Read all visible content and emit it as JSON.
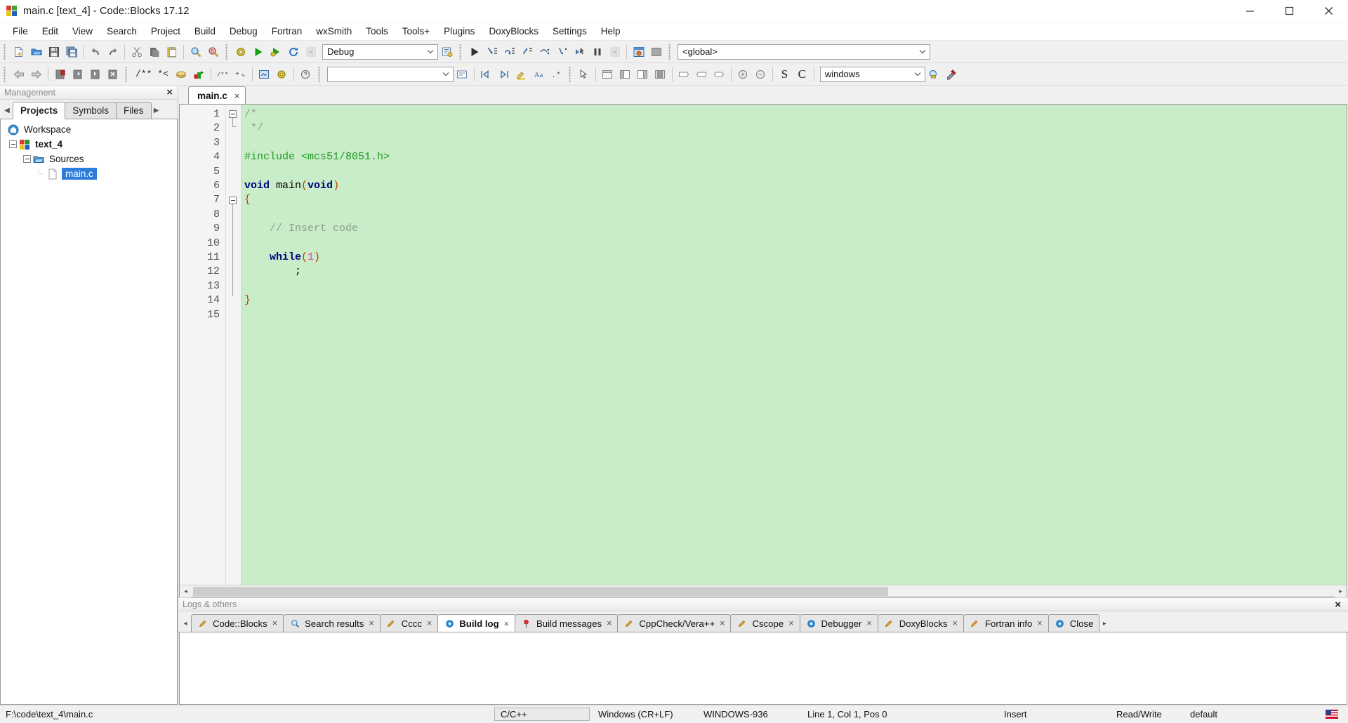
{
  "window": {
    "title": "main.c [text_4] - Code::Blocks 17.12",
    "app_icon": "codeblocks-logo-icon",
    "minimize_label": "Minimize",
    "maximize_label": "Maximize",
    "close_label": "Close"
  },
  "menubar": {
    "items": [
      {
        "label": "File"
      },
      {
        "label": "Edit"
      },
      {
        "label": "View"
      },
      {
        "label": "Search"
      },
      {
        "label": "Project"
      },
      {
        "label": "Build"
      },
      {
        "label": "Debug"
      },
      {
        "label": "Fortran"
      },
      {
        "label": "wxSmith"
      },
      {
        "label": "Tools"
      },
      {
        "label": "Tools+"
      },
      {
        "label": "Plugins"
      },
      {
        "label": "DoxyBlocks"
      },
      {
        "label": "Settings"
      },
      {
        "label": "Help"
      }
    ]
  },
  "toolbar_main": {
    "buttons": [
      {
        "name": "new-file-icon",
        "title": "New file"
      },
      {
        "name": "open-file-icon",
        "title": "Open"
      },
      {
        "name": "save-icon",
        "title": "Save"
      },
      {
        "name": "save-all-icon",
        "title": "Save all files"
      },
      {
        "name": "undo-icon",
        "title": "Undo"
      },
      {
        "name": "redo-icon",
        "title": "Redo"
      },
      {
        "name": "cut-icon",
        "title": "Cut"
      },
      {
        "name": "copy-icon",
        "title": "Copy"
      },
      {
        "name": "paste-icon",
        "title": "Paste"
      },
      {
        "name": "find-icon",
        "title": "Find"
      },
      {
        "name": "replace-icon",
        "title": "Replace"
      },
      {
        "name": "build-icon",
        "title": "Build"
      },
      {
        "name": "run-icon",
        "title": "Run"
      },
      {
        "name": "build-and-run-icon",
        "title": "Build and run"
      },
      {
        "name": "rebuild-icon",
        "title": "Rebuild"
      },
      {
        "name": "abort-icon",
        "title": "Abort"
      }
    ],
    "target_combo": {
      "value": "Debug",
      "name": "build-target-select"
    },
    "select-target-icon": "select-target-icon",
    "debug_buttons": [
      {
        "name": "debug-continue-icon",
        "title": "Debug / Continue"
      },
      {
        "name": "step-into-icon",
        "title": "Step into"
      },
      {
        "name": "step-over-icon",
        "title": "Next line"
      },
      {
        "name": "step-out-icon",
        "title": "Step out"
      },
      {
        "name": "next-instruction-icon",
        "title": "Next instruction"
      },
      {
        "name": "step-into-instruction-icon",
        "title": "Step into instruction"
      },
      {
        "name": "run-to-cursor-icon",
        "title": "Run to cursor"
      },
      {
        "name": "break-debugger-icon",
        "title": "Break debugger"
      },
      {
        "name": "stop-debugger-icon",
        "title": "Stop debugger"
      }
    ],
    "debug_windows_icon": "debugging-windows-icon",
    "debug_info_icon": "various-info-icon",
    "scope_combo": {
      "value": "<global>",
      "name": "scope-select"
    }
  },
  "toolbar_secondary": {
    "nav_buttons": [
      {
        "name": "back-icon",
        "title": "Navigate back"
      },
      {
        "name": "forward-icon",
        "title": "Navigate forward"
      }
    ],
    "bookmark_buttons": [
      {
        "name": "toggle-bookmark-icon",
        "title": "Toggle bookmark"
      },
      {
        "name": "previous-bookmark-icon",
        "title": "Previous bookmark"
      },
      {
        "name": "next-bookmark-icon",
        "title": "Next bookmark"
      },
      {
        "name": "clear-bookmarks-icon",
        "title": "Clear all bookmarks"
      }
    ],
    "doxy_label": "/** *<",
    "doxyblocks_buttons": [
      {
        "name": "doxyblocks-comment-icon",
        "title": "DoxyBlocks comment"
      },
      {
        "name": "doxyblocks-run-icon",
        "title": "Run DoxyBlocks"
      },
      {
        "name": "doxyblocks-extract-icon",
        "title": "Extract documentation"
      },
      {
        "name": "doxyblocks-config-icon",
        "title": "Configure DoxyBlocks"
      },
      {
        "name": "doxyblocks-help-icon",
        "title": "DoxyBlocks help"
      }
    ],
    "search_combo": {
      "value": "",
      "placeholder": "",
      "name": "incremental-search-input"
    },
    "search_buttons": [
      {
        "name": "search-prev-icon",
        "title": "Previous match"
      },
      {
        "name": "search-next-icon",
        "title": "Next match"
      },
      {
        "name": "highlight-icon",
        "title": "Highlight all"
      },
      {
        "name": "match-case-icon",
        "title": "Match case"
      },
      {
        "name": "regex-icon",
        "title": "Use regex"
      }
    ],
    "wxsmith_buttons": [
      {
        "name": "pointer-icon",
        "title": "Select"
      },
      {
        "name": "panel-icon",
        "title": "Panel"
      },
      {
        "name": "layout-left-icon",
        "title": "Layout left"
      },
      {
        "name": "layout-right-icon",
        "title": "Layout right"
      },
      {
        "name": "layout-center-icon",
        "title": "Layout center"
      },
      {
        "name": "align-left-icon",
        "title": "Align left"
      },
      {
        "name": "align-center-icon",
        "title": "Align center"
      },
      {
        "name": "align-right-icon",
        "title": "Align right"
      },
      {
        "name": "expand-icon",
        "title": "Expand"
      },
      {
        "name": "collapse-icon",
        "title": "Collapse"
      },
      {
        "name": "fit-icon",
        "title": "Fit"
      },
      {
        "name": "zoom-in-icon",
        "title": "Zoom in"
      },
      {
        "name": "zoom-out-icon",
        "title": "Zoom out"
      }
    ],
    "symbol_s": "S",
    "symbol_c": "C",
    "platform_combo": {
      "value": "windows",
      "name": "wxsmith-platform-select"
    },
    "right_buttons": [
      {
        "name": "preview-icon",
        "title": "Preview"
      },
      {
        "name": "properties-icon",
        "title": "Properties"
      }
    ]
  },
  "management": {
    "panel_title": "Management",
    "close_label": "×",
    "tabs": [
      {
        "label": "Projects",
        "active": true
      },
      {
        "label": "Symbols",
        "active": false
      },
      {
        "label": "Files",
        "active": false
      }
    ],
    "tree": [
      {
        "label": "Workspace",
        "icon": "workspace-icon",
        "indent": 0,
        "bold": false,
        "selected": false,
        "expander": false
      },
      {
        "label": "text_4",
        "icon": "project-icon",
        "indent": 1,
        "bold": true,
        "selected": false,
        "expander": true
      },
      {
        "label": "Sources",
        "icon": "folder-icon",
        "indent": 2,
        "bold": false,
        "selected": false,
        "expander": true
      },
      {
        "label": "main.c",
        "icon": "file-icon",
        "indent": 3,
        "bold": false,
        "selected": true,
        "expander": false
      }
    ]
  },
  "editor": {
    "tabs": [
      {
        "label": "main.c",
        "close": "×",
        "active": true
      }
    ],
    "line_numbers": [
      1,
      2,
      3,
      4,
      5,
      6,
      7,
      8,
      9,
      10,
      11,
      12,
      13,
      14,
      15
    ],
    "lines": [
      {
        "n": 1,
        "segments": [
          {
            "t": "/*",
            "c": "k-cmt"
          }
        ]
      },
      {
        "n": 2,
        "segments": [
          {
            "t": " */",
            "c": "k-cmt"
          }
        ]
      },
      {
        "n": 3,
        "segments": [
          {
            "t": "",
            "c": ""
          }
        ]
      },
      {
        "n": 4,
        "segments": [
          {
            "t": "#include <mcs51/8051.h>",
            "c": "k-pre"
          }
        ]
      },
      {
        "n": 5,
        "segments": [
          {
            "t": "",
            "c": ""
          }
        ]
      },
      {
        "n": 6,
        "segments": [
          {
            "t": "void",
            "c": "k-key"
          },
          {
            "t": " main",
            "c": "k-fn"
          },
          {
            "t": "(",
            "c": "k-par"
          },
          {
            "t": "void",
            "c": "k-key"
          },
          {
            "t": ")",
            "c": "k-par"
          }
        ]
      },
      {
        "n": 7,
        "segments": [
          {
            "t": "{",
            "c": "k-par"
          }
        ]
      },
      {
        "n": 8,
        "segments": [
          {
            "t": "",
            "c": ""
          }
        ]
      },
      {
        "n": 9,
        "segments": [
          {
            "t": "    // Insert code",
            "c": "k-cmt"
          }
        ]
      },
      {
        "n": 10,
        "segments": [
          {
            "t": "",
            "c": ""
          }
        ]
      },
      {
        "n": 11,
        "segments": [
          {
            "t": "    while",
            "c": "k-key"
          },
          {
            "t": "(",
            "c": "k-par"
          },
          {
            "t": "1",
            "c": "k-num"
          },
          {
            "t": ")",
            "c": "k-par"
          }
        ]
      },
      {
        "n": 12,
        "segments": [
          {
            "t": "        ;",
            "c": "k-fn"
          }
        ]
      },
      {
        "n": 13,
        "segments": [
          {
            "t": "",
            "c": ""
          }
        ]
      },
      {
        "n": 14,
        "segments": [
          {
            "t": "}",
            "c": "k-par"
          }
        ]
      },
      {
        "n": 15,
        "segments": [
          {
            "t": "",
            "c": ""
          }
        ]
      }
    ],
    "background_color": "#c9ecc9",
    "scroll_left_label": "◂",
    "scroll_right_label": "▸"
  },
  "logs": {
    "panel_title": "Logs & others",
    "close_label": "×",
    "scroll_left": "◂",
    "scroll_right": "▸",
    "tabs": [
      {
        "label": "Code::Blocks",
        "icon": "pencil-icon",
        "active": false,
        "close": "×"
      },
      {
        "label": "Search results",
        "icon": "magnifier-icon",
        "active": false,
        "close": "×"
      },
      {
        "label": "Cccc",
        "icon": "pencil-icon",
        "active": false,
        "close": "×"
      },
      {
        "label": "Build log",
        "icon": "gear-blue-icon",
        "active": true,
        "close": "×"
      },
      {
        "label": "Build messages",
        "icon": "pin-icon",
        "active": false,
        "close": "×"
      },
      {
        "label": "CppCheck/Vera++",
        "icon": "pencil-icon",
        "active": false,
        "close": "×"
      },
      {
        "label": "Cscope",
        "icon": "pencil-icon",
        "active": false,
        "close": "×"
      },
      {
        "label": "Debugger",
        "icon": "gear-blue-icon",
        "active": false,
        "close": "×"
      },
      {
        "label": "DoxyBlocks",
        "icon": "pencil-icon",
        "active": false,
        "close": "×"
      },
      {
        "label": "Fortran info",
        "icon": "pencil-icon",
        "active": false,
        "close": "×"
      },
      {
        "label": "Close",
        "icon": "gear-blue-icon",
        "active": false,
        "close": ""
      }
    ],
    "content": ""
  },
  "statusbar": {
    "path": "F:\\code\\text_4\\main.c",
    "language": "C/C++",
    "eol": "Windows (CR+LF)",
    "encoding": "WINDOWS-936",
    "position": "Line 1, Col 1, Pos 0",
    "insert_mode": "Insert",
    "access": "Read/Write",
    "profile": "default",
    "ime_icon": "ime-indicator-icon"
  }
}
